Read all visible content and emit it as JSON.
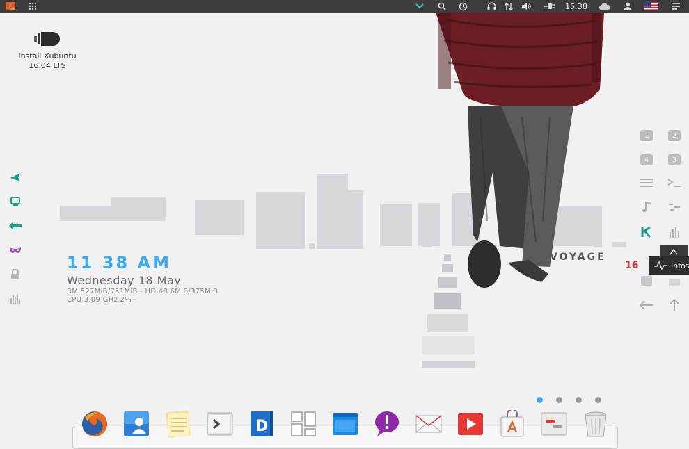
{
  "top_panel": {
    "clock": "15:38",
    "icons": [
      "menu-logo-icon",
      "apps-grid-icon",
      "chevron-down-icon",
      "search-icon",
      "history-icon",
      "headphones-icon",
      "network-updown-icon",
      "volume-icon",
      "power-plug-icon",
      "cloud-icon",
      "user-icon",
      "us-flag-icon",
      "hamburger-menu-icon"
    ]
  },
  "desktop": {
    "install_label_line1": "Install Xubuntu",
    "install_label_line2": "16.04 LTS"
  },
  "conky": {
    "time": "11 38 AM",
    "date": "Wednesday 18 May",
    "rm": "RM 527MiB/751MiB - HD 48.6MiB/375MiB",
    "cpu": "CPU 3.09 GHz 2% -"
  },
  "wallpaper": {
    "voyager_text": "VOYAGE",
    "voyager_num": "16"
  },
  "right_launcher": {
    "ws1": "1",
    "ws2": "2",
    "ws4": "4",
    "ws3": "3"
  },
  "tooltip": {
    "text": "Infos"
  },
  "left_dock": {
    "icons": [
      "plane-icon",
      "monitor-icon",
      "arrow-left-icon",
      "mask-icon",
      "lock-icon",
      "bars-chart-icon"
    ]
  },
  "bottom_dock": {
    "apps": [
      "firefox-icon",
      "contacts-icon",
      "notes-icon",
      "terminal-icon",
      "dictionary-icon",
      "tiles-icon",
      "window-icon",
      "chat-icon",
      "mail-icon",
      "video-icon",
      "store-icon",
      "settings-icon",
      "trash-icon"
    ]
  },
  "colors": {
    "accent_blue": "#3ba8f0",
    "panel_bg": "#3c3c3c",
    "desktop_bg": "#f1f1f2",
    "teal": "#18a08a",
    "purple": "#9b59b6"
  }
}
